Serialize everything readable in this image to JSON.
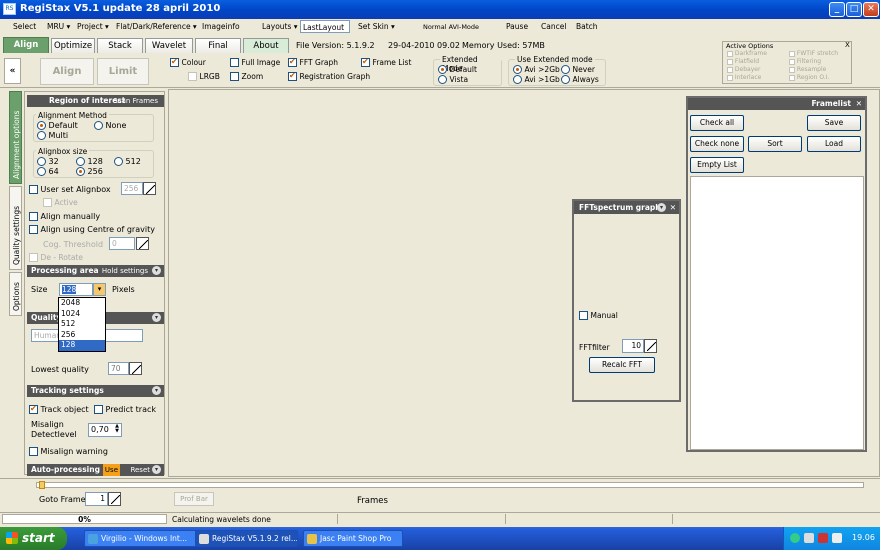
{
  "window": {
    "title": "RegiStax V5.1 update 28 april 2010",
    "icon_text": "RS"
  },
  "menu": {
    "select": "Select",
    "mru": "MRU ▾",
    "project": "Project ▾",
    "flat": "Flat/Dark/Reference ▾",
    "imageinfo": "Imageinfo",
    "layouts": "Layouts ▾",
    "layout_value": "LastLayout",
    "set_skin": "Set Skin ▾",
    "avi_mode": "Normal AVI-Mode",
    "pause": "Pause",
    "cancel": "Cancel",
    "batch": "Batch"
  },
  "tabs": [
    "Align",
    "Optimize",
    "Stack",
    "Wavelet",
    "Final",
    "About"
  ],
  "fileinfo": {
    "version": "File Version: 5.1.9.2",
    "date": "29-04-2010 09.02",
    "memory": "Memory Used: 57MB"
  },
  "toolbar": {
    "align": "Align",
    "limit": "Limit",
    "colour": "Colour",
    "full_image": "Full Image",
    "fft_graph": "FFT Graph",
    "frame_list": "Frame List",
    "lrgb": "LRGB",
    "zoom": "Zoom",
    "registration_graph": "Registration Graph",
    "extended_mode": "Extended Mode",
    "em_default": "Default",
    "em_vista": "Vista",
    "use_extended": "Use  Extended mode",
    "avi_2gb": "Avi >2Gb",
    "avi_1gb": "Avi >1Gb",
    "never": "Never",
    "always": "Always"
  },
  "active_options": {
    "title": "Active Options",
    "close": "X",
    "items": [
      "Darkframe",
      "FWTIF stretch",
      "Flatfield",
      "Filtering",
      "Debayer",
      "Resample",
      "Interlace",
      "Region O.I."
    ]
  },
  "vertical_tabs": [
    "Alignment options",
    "Quality settings",
    "Options"
  ],
  "left": {
    "roi_header": "Region of interest",
    "scan_frames": "Scan Frames",
    "alignment_method": "Alignment Method",
    "am_default": "Default",
    "am_none": "None",
    "am_multi": "Multi",
    "alignbox_size": "Alignbox size",
    "sizes": [
      "32",
      "128",
      "512",
      "64",
      "256"
    ],
    "user_set_alignbox": "User set Alignbox",
    "user_alignbox_value": "256",
    "active": "Active",
    "align_manually": "Align manually",
    "align_cog": "Align using Centre of gravity",
    "cog_threshold": "Cog. Threshold",
    "cog_value": "0",
    "de_rotate": "De - Rotate",
    "processing_area": "Processing area",
    "hold_settings": "Hold settings",
    "size_label": "Size",
    "size_value": "128",
    "pixels": "Pixels",
    "size_options": [
      "2048",
      "1024",
      "512",
      "256",
      "128"
    ],
    "quality_header": "Quality",
    "quality_combo": "Human",
    "lowest_quality": "Lowest quality",
    "lowest_quality_value": "70",
    "tracking_header": "Tracking settings",
    "track_object": "Track object",
    "predict_track": "Predict track",
    "misalign_detect": "Misalign\nDetectlevel",
    "misalign_value": "0,70",
    "misalign_warning": "Misalign warning",
    "auto_processing": "Auto-processing",
    "use": "Use",
    "reset": "Reset"
  },
  "framelist": {
    "title": "Framelist",
    "check_all": "Check all",
    "save": "Save",
    "check_none": "Check none",
    "sort": "Sort",
    "load": "Load",
    "empty_list": "Empty List"
  },
  "fft": {
    "title": "FFTspectrum graph",
    "manual": "Manual",
    "fftfilter": "FFTfilter",
    "fftfilter_value": "10",
    "recalc": "Recalc FFT"
  },
  "bottom": {
    "goto_frame": "Goto Frame",
    "goto_value": "1",
    "prof_bar": "Prof Bar",
    "frames": "Frames"
  },
  "status": {
    "progress": "0%",
    "message": "Calculating wavelets done"
  },
  "taskbar": {
    "start": "start",
    "items": [
      "Virgilio - Windows Int...",
      "RegiStax V5.1.9.2 rel...",
      "Jasc Paint Shop Pro"
    ],
    "clock": "19.06"
  }
}
